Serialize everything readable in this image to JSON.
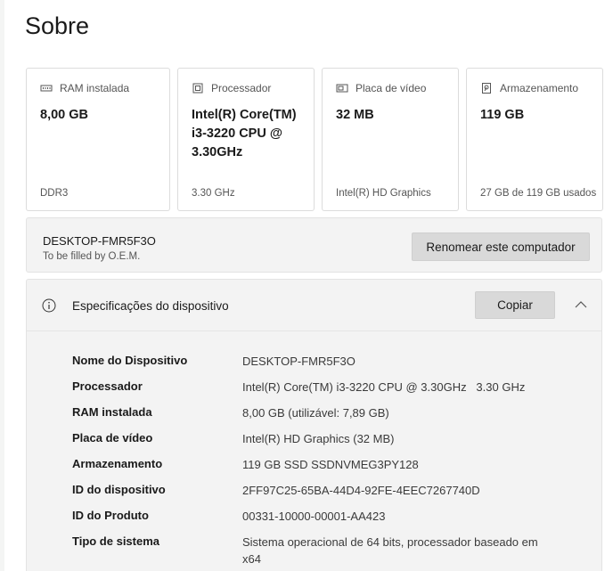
{
  "page": {
    "title": "Sobre"
  },
  "cards": [
    {
      "icon": "ram-icon",
      "label": "RAM instalada",
      "value": "8,00 GB",
      "sub": "DDR3"
    },
    {
      "icon": "processor-icon",
      "label": "Processador",
      "value": "Intel(R) Core(TM) i3-3220 CPU @ 3.30GHz",
      "sub": "3.30 GHz"
    },
    {
      "icon": "video-card-icon",
      "label": "Placa de vídeo",
      "value": "32 MB",
      "sub": "Intel(R) HD Graphics"
    },
    {
      "icon": "storage-icon",
      "label": "Armazenamento",
      "value": "119 GB",
      "sub": "27 GB de 119 GB usados"
    }
  ],
  "device": {
    "name": "DESKTOP-FMR5F3O",
    "oem": "To be filled by O.E.M.",
    "rename_label": "Renomear este computador"
  },
  "specs": {
    "title": "Especificações do dispositivo",
    "copy_label": "Copiar",
    "rows": [
      {
        "label": "Nome do Dispositivo",
        "value": "DESKTOP-FMR5F3O"
      },
      {
        "label": "Processador",
        "value": "Intel(R) Core(TM) i3-3220 CPU @ 3.30GHz   3.30 GHz"
      },
      {
        "label": "RAM instalada",
        "value": "8,00 GB (utilizável: 7,89 GB)"
      },
      {
        "label": "Placa de vídeo",
        "value": "Intel(R) HD Graphics (32 MB)"
      },
      {
        "label": "Armazenamento",
        "value": "119 GB SSD SSDNVMEG3PY128"
      },
      {
        "label": "ID do dispositivo",
        "value": "2FF97C25-65BA-44D4-92FE-4EEC7267740D"
      },
      {
        "label": "ID do Produto",
        "value": "00331-10000-00001-AA423"
      },
      {
        "label": "Tipo de sistema",
        "value": "Sistema operacional de 64 bits, processador baseado em x64"
      }
    ]
  }
}
